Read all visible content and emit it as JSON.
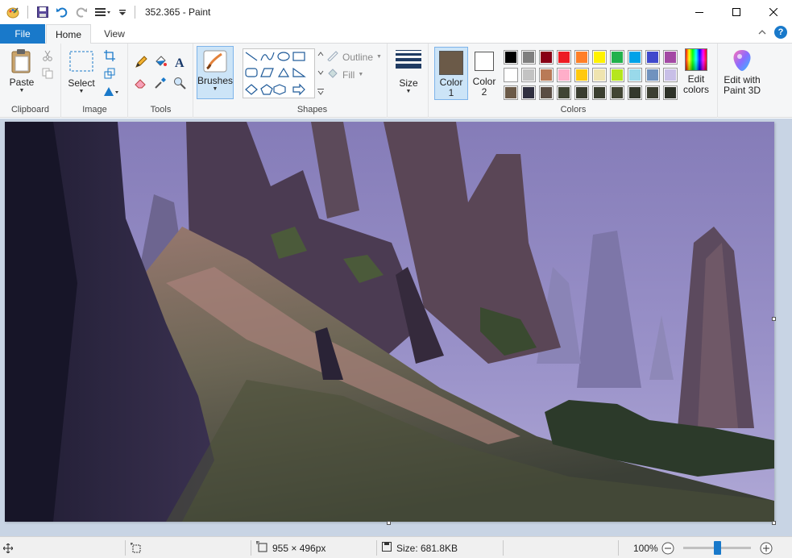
{
  "window": {
    "title": "352.365 - Paint"
  },
  "tabs": {
    "file": "File",
    "home": "Home",
    "view": "View"
  },
  "clipboard": {
    "paste_label": "Paste",
    "group_label": "Clipboard"
  },
  "image": {
    "select_label": "Select",
    "group_label": "Image"
  },
  "tools": {
    "group_label": "Tools"
  },
  "brushes": {
    "label": "Brushes"
  },
  "shapes": {
    "outline_label": "Outline",
    "fill_label": "Fill",
    "group_label": "Shapes"
  },
  "size": {
    "label": "Size"
  },
  "colors": {
    "color1_label": "Color",
    "color1_num": "1",
    "color2_label": "Color",
    "color2_num": "2",
    "edit_label1": "Edit",
    "edit_label2": "colors",
    "group_label": "Colors",
    "color1_value": "#6b5a48",
    "color2_value": "#ffffff",
    "palette": [
      "#000000",
      "#7f7f7f",
      "#880015",
      "#ed1c24",
      "#ff7f27",
      "#fff200",
      "#22b14c",
      "#00a2e8",
      "#3f48cc",
      "#a349a4",
      "#ffffff",
      "#c3c3c3",
      "#b97a57",
      "#ffaec9",
      "#ffc90e",
      "#efe4b0",
      "#b5e61d",
      "#99d9ea",
      "#7092be",
      "#c8bfe7",
      "#6b5a48",
      "#303040",
      "#5a4d44",
      "#404534",
      "#3a3d30",
      "#3b3f30",
      "#424534",
      "#33382c",
      "#3c3f32",
      "#2e3229"
    ]
  },
  "paint3d": {
    "label1": "Edit with",
    "label2": "Paint 3D"
  },
  "status": {
    "dimensions": "955 × 496px",
    "size": "Size: 681.8KB",
    "zoom": "100%"
  }
}
